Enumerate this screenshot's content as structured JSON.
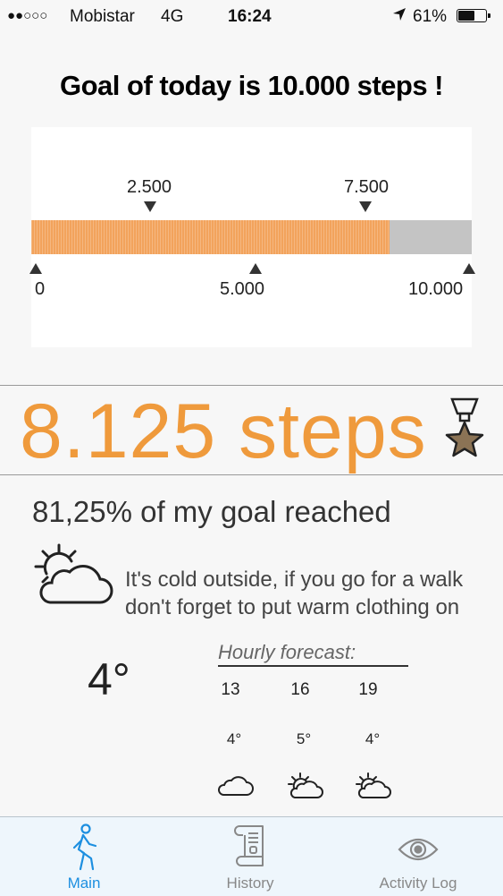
{
  "status_bar": {
    "signal": "●●○○○",
    "carrier": "Mobistar",
    "network": "4G",
    "time": "16:24",
    "battery": "61%",
    "battery_level": 0.61
  },
  "goal": {
    "title": "Goal of today is 10.000 steps !",
    "target": 10000,
    "current": 8125,
    "progress_fraction": 0.8125,
    "markers_top": [
      "2.500",
      "7.500"
    ],
    "markers_bottom": [
      "0",
      "5.000",
      "10.000"
    ]
  },
  "steps": {
    "label": "8.125 steps",
    "goal_reached": "81,25% of my goal reached"
  },
  "weather": {
    "icon": "partly-cloudy-icon",
    "message_line1": "It's cold outside, if you go for a walk",
    "message_line2": "don't forget to put warm clothing on",
    "current_temp": "4°",
    "hourly_title": "Hourly forecast:",
    "hourly": [
      {
        "hour": "13",
        "temp": "4°",
        "icon": "cloud-icon"
      },
      {
        "hour": "16",
        "temp": "5°",
        "icon": "partly-cloudy-icon"
      },
      {
        "hour": "19",
        "temp": "4°",
        "icon": "partly-cloudy-icon"
      }
    ]
  },
  "tabs": [
    {
      "label": "Main",
      "icon": "walking-person-icon",
      "active": true
    },
    {
      "label": "History",
      "icon": "scroll-icon",
      "active": false
    },
    {
      "label": "Activity Log",
      "icon": "eye-icon",
      "active": false
    }
  ],
  "colors": {
    "accent_orange": "#ef9a3c",
    "bar_fill": "#f2a35c",
    "bar_track": "#c4c4c4",
    "tab_active": "#1d8fe0",
    "medal_star": "#8b7355"
  }
}
